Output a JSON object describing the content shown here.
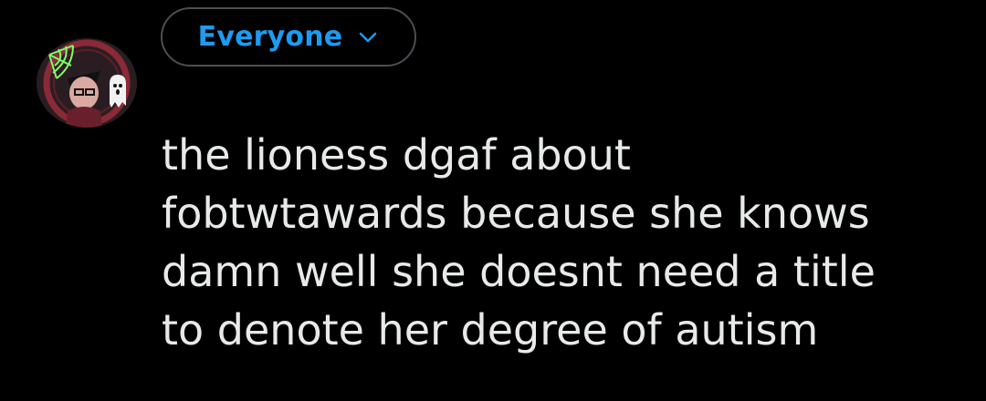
{
  "composer": {
    "audience_label": "Everyone",
    "post_text": "the lioness dgaf about\nfobtwtawards because she knows\ndamn well she doesnt need a title\nto denote her degree of autism"
  },
  "icons": {
    "avatar": "profile-photo",
    "audience_chevron": "chevron-down-icon"
  },
  "colors": {
    "background": "#000000",
    "accent": "#1d9bf0",
    "text": "#e7e9ea",
    "border": "#4a4f54"
  }
}
